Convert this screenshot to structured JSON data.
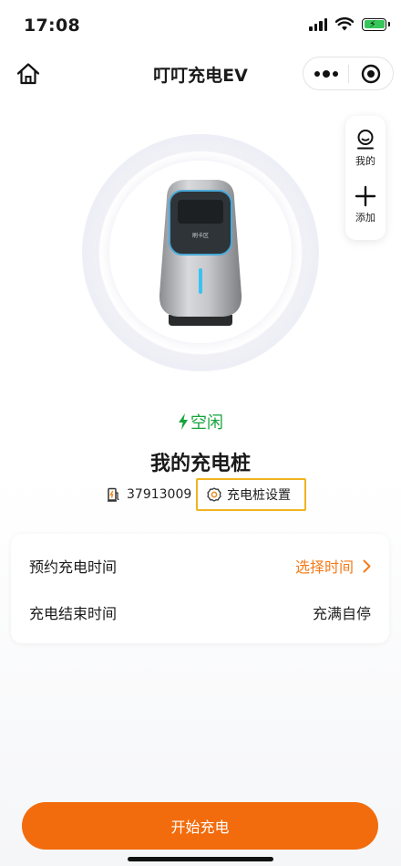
{
  "status_bar": {
    "time": "17:08",
    "icons": [
      "signal-icon",
      "wifi-icon",
      "battery-charging-icon"
    ],
    "battery_color": "#35c759"
  },
  "nav": {
    "title": "叮叮充电EV",
    "left_icon": "home-icon",
    "capsule_icons": [
      "more-icon",
      "close-target-icon"
    ]
  },
  "side_panel": {
    "items": [
      {
        "label": "我的",
        "icon": "profile-icon"
      },
      {
        "label": "添加",
        "icon": "plus-icon"
      }
    ]
  },
  "device": {
    "state": "空闲",
    "state_color": "#17a33c",
    "name": "我的充电桩",
    "id": "37913009",
    "id_icon": "charger-pile-icon",
    "settings_label": "充电桩设置",
    "settings_icon": "gear-icon",
    "charger_screen_text": "刷卡区"
  },
  "schedule_card": {
    "rows": [
      {
        "label": "预约充电时间",
        "value": "选择时间",
        "icon": "chevron-right-icon"
      },
      {
        "label": "充电结束时间",
        "value": "充满自停"
      }
    ],
    "accent": "#f57a18"
  },
  "actions": {
    "start_label": "开始充电",
    "start_color": "#f26c0d"
  }
}
